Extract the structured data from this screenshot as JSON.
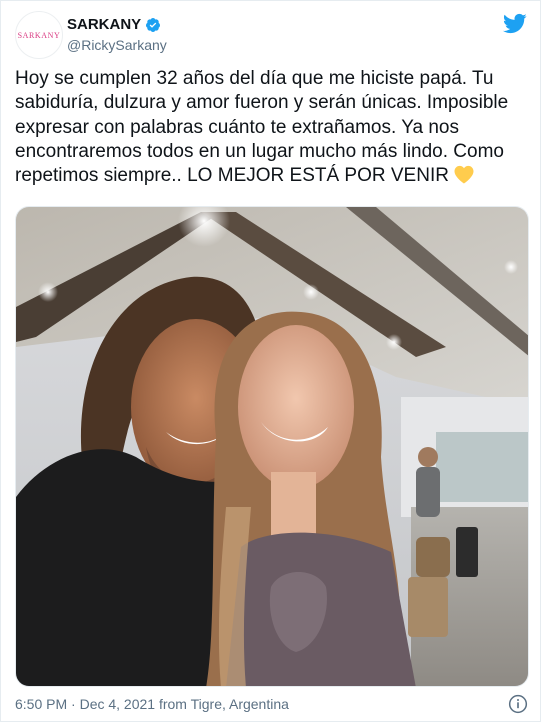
{
  "author": {
    "display_name": "SARKANY",
    "handle": "@RickySarkany",
    "avatar_text": "SARKANY",
    "verified": true,
    "verified_color": "#1da1f2"
  },
  "brand": {
    "logo": "twitter-bird-icon",
    "color": "#1da1f2"
  },
  "tweet": {
    "text": "Hoy se cumplen 32 años del día que me hiciste papá. Tu sabiduría, dulzura y amor fueron y serán únicas. Imposible expresar con palabras cuánto te extrañamos. Ya nos encontraremos todos en un lugar mucho más lindo. Como repetimos siempre.. LO MEJOR ESTÁ POR VENIR",
    "emoji": "yellow-heart-icon",
    "emoji_color": "#ffcc4d",
    "media": "photo",
    "timestamp": "6:50 PM · Dec 4, 2021 from Tigre, Argentina"
  },
  "icons": {
    "info": "info-icon"
  }
}
